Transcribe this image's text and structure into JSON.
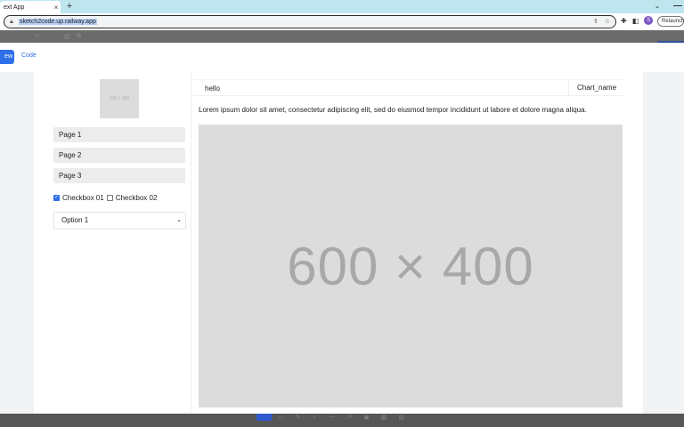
{
  "browser": {
    "tab_title": "ext App",
    "tab_close": "×",
    "new_tab": "+",
    "url": "sketch2code.up.railway.app",
    "profile_initial": "S",
    "relaunch_label": "Relaunch"
  },
  "toolbar": {
    "preview_label": "ew",
    "code_label": "Code"
  },
  "sidebar": {
    "logo_text": "300 × 300",
    "items": [
      {
        "label": "Page 1"
      },
      {
        "label": "Page 2"
      },
      {
        "label": "Page 3"
      }
    ],
    "checkboxes": [
      {
        "label": "Checkbox 01",
        "checked": true
      },
      {
        "label": "Checkbox 02",
        "checked": false
      }
    ],
    "select_value": "Option 1"
  },
  "main": {
    "input_value": "hello",
    "chart_name": "Chart_name",
    "paragraph": "Lorem ipsum dolor sit amet, consectetur adipiscing elit, sed do eiusmod tempor incididunt ut labore et dolore magna aliqua.",
    "image_placeholder": "600 × 400"
  },
  "colors": {
    "accent": "#2f6fea",
    "placeholder_bg": "#dcdcdc",
    "tab_strip": "#bfe6ee"
  }
}
